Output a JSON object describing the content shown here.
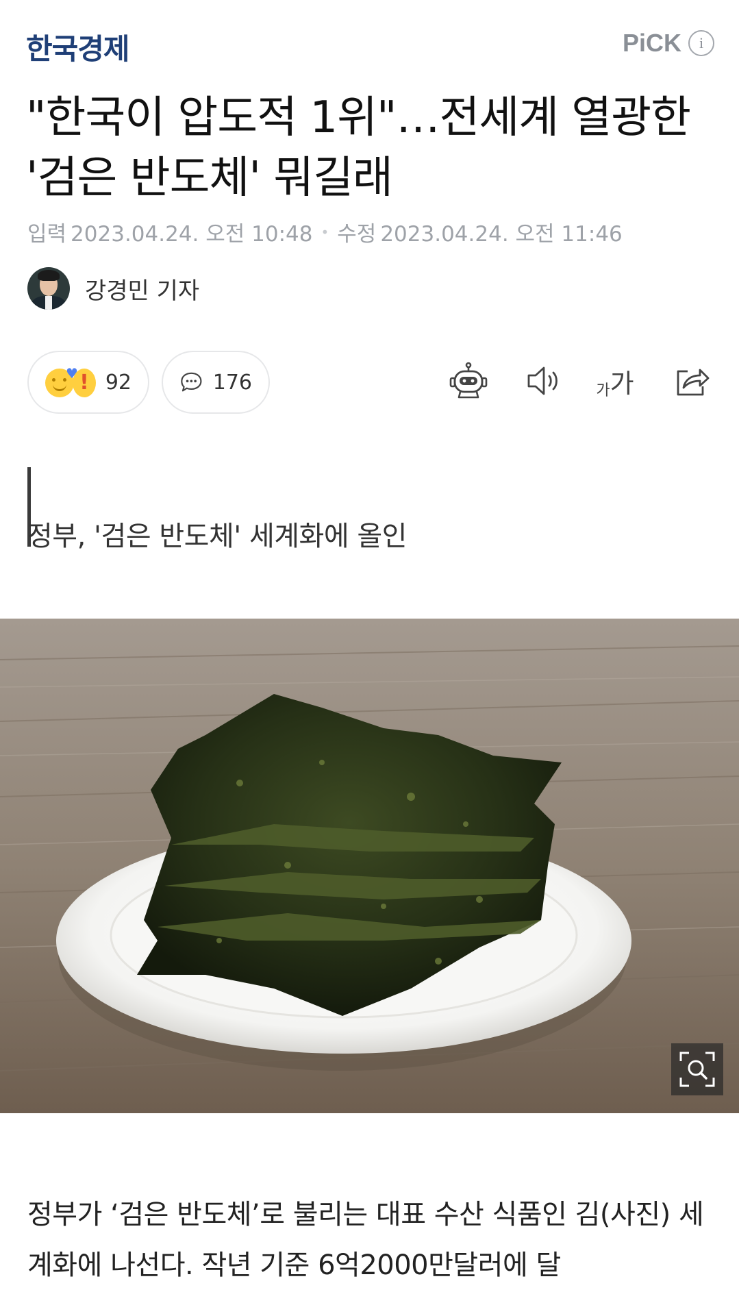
{
  "header": {
    "logo": "한국경제",
    "pick_label": "PiCK",
    "info_glyph": "i"
  },
  "article": {
    "title": "\"한국이 압도적 1위\"…전세계 열광한 '검은 반도체' 뭐길래",
    "input_label": "입력",
    "input_time": "2023.04.24. 오전 10:48",
    "edit_label": "수정",
    "edit_time": "2023.04.24. 오전 11:46",
    "author": "강경민 기자",
    "subtitle": "정부, '검은 반도체' 세계화에 올인",
    "body": "정부가 ‘검은 반도체’로 불리는 대표 수산 식품인 김(사진) 세계화에 나선다. 작년 기준 6억2000만달러에 달"
  },
  "reactions": {
    "like_count": "92",
    "comment_count": "176"
  },
  "toolbar": {
    "icons": [
      "robot-summary-icon",
      "speaker-icon",
      "font-size-icon",
      "share-icon"
    ],
    "font_small": "가",
    "font_big": "가"
  },
  "colors": {
    "logo": "#1f3f77",
    "meta": "#9ea2a8",
    "pill_border": "#e6e7e9",
    "quote_bar": "#3a3a3a"
  }
}
